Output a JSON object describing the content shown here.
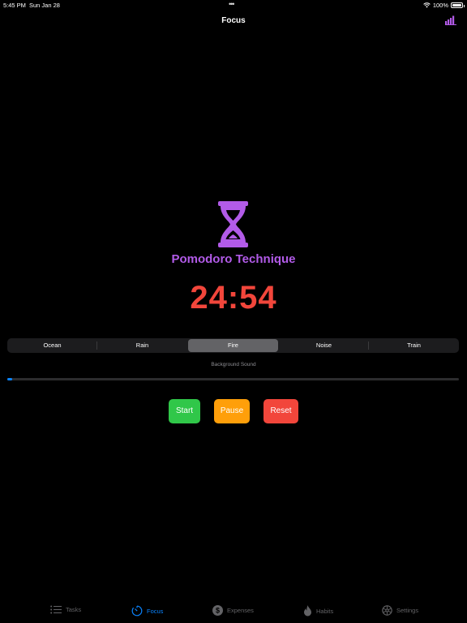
{
  "status_bar": {
    "time": "5:45 PM",
    "date": "Sun Jan 28",
    "dots": "•••",
    "battery": "100%"
  },
  "nav": {
    "title": "Focus"
  },
  "hero": {
    "title": "Pomodoro Technique",
    "timer": "24:54",
    "icon": "hourglass-icon"
  },
  "sounds": {
    "options": [
      "Ocean",
      "Rain",
      "Fire",
      "Noise",
      "Train"
    ],
    "selected": "Fire",
    "label": "Background Sound",
    "volume_fraction": 0.01
  },
  "controls": {
    "start": "Start",
    "pause": "Pause",
    "reset": "Reset"
  },
  "tabs": [
    {
      "label": "Tasks",
      "icon": "list-icon",
      "active": false
    },
    {
      "label": "Focus",
      "icon": "timer-icon",
      "active": true
    },
    {
      "label": "Expenses",
      "icon": "dollar-icon",
      "active": false
    },
    {
      "label": "Habits",
      "icon": "flame-icon",
      "active": false
    },
    {
      "label": "Settings",
      "icon": "gear-icon",
      "active": false
    }
  ],
  "colors": {
    "accent_purple": "#b25be8",
    "timer_red": "#f2463b",
    "start_green": "#30c749",
    "pause_orange": "#ff9f0a",
    "reset_red": "#f2463b",
    "active_tab_blue": "#0a84ff"
  }
}
